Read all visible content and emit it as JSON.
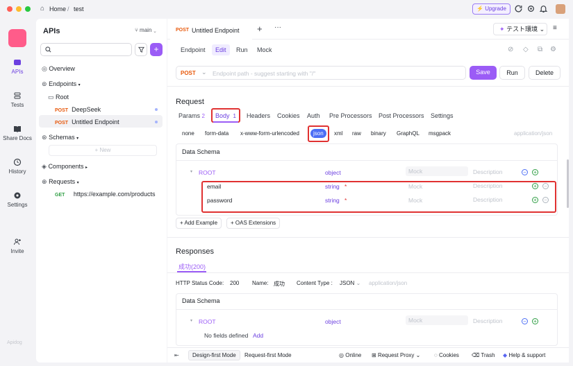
{
  "titlebar": {
    "home": "Home",
    "separator": "/",
    "project": "test",
    "upgrade": "Upgrade",
    "icons": [
      "refresh-icon",
      "gear-icon",
      "bell-icon"
    ]
  },
  "rail": {
    "items": [
      {
        "label": "APIs",
        "icon": "api-icon"
      },
      {
        "label": "Tests",
        "icon": "tests-icon"
      },
      {
        "label": "Share Docs",
        "icon": "book-icon"
      },
      {
        "label": "History",
        "icon": "history-icon"
      },
      {
        "label": "Settings",
        "icon": "settings-icon"
      },
      {
        "label": "Invite",
        "icon": "invite-icon"
      }
    ],
    "watermark": "Apidog"
  },
  "sidebar": {
    "title": "APIs",
    "branch": "main",
    "new_label": "+ New",
    "overview": "Overview",
    "endpoints": "Endpoints",
    "root": "Root",
    "ep1_method": "POST",
    "ep1_name": "DeepSeek",
    "ep2_method": "POST",
    "ep2_name": "Untitled Endpoint",
    "schemas": "Schemas",
    "components": "Components",
    "requests": "Requests",
    "req_method": "GET",
    "req_url": "https://example.com/products"
  },
  "tabs": {
    "method": "POST",
    "title": "Untitled Endpoint",
    "env": "テスト環境"
  },
  "subtabs": {
    "endpoint": "Endpoint",
    "edit": "Edit",
    "run": "Run",
    "mock": "Mock"
  },
  "urlbar": {
    "method": "POST",
    "placeholder": "Endpoint path - suggest starting with \"/\"",
    "save": "Save",
    "run": "Run",
    "delete": "Delete"
  },
  "request": {
    "title": "Request",
    "tabs": [
      {
        "label": "Params",
        "count": "2"
      },
      {
        "label": "Body",
        "count": "1"
      },
      {
        "label": "Headers"
      },
      {
        "label": "Cookies"
      },
      {
        "label": "Auth"
      },
      {
        "label": "Pre Processors"
      },
      {
        "label": "Post Processors"
      },
      {
        "label": "Settings"
      }
    ],
    "formats": [
      "none",
      "form-data",
      "x-www-form-urlencoded",
      "json",
      "xml",
      "raw",
      "binary",
      "GraphQL",
      "msgpack"
    ],
    "content_type": "application/json",
    "schema_title": "Data Schema",
    "root": "ROOT",
    "root_type": "object",
    "mock_ph": "Mock",
    "desc_ph": "Description",
    "fields": [
      {
        "name": "email",
        "type": "string",
        "required": "*"
      },
      {
        "name": "password",
        "type": "string",
        "required": "*"
      }
    ],
    "add_example": "+ Add Example",
    "oas": "+ OAS Extensions"
  },
  "responses": {
    "title": "Responses",
    "tab": "成功(200)",
    "status_label": "HTTP Status Code:",
    "status": "200",
    "name_label": "Name:",
    "name": "成功",
    "ctype_label": "Content Type :",
    "ctype": "JSON",
    "ctype_hint": "application/json",
    "schema_title": "Data Schema",
    "root": "ROOT",
    "root_type": "object",
    "no_fields": "No fields defined",
    "add": "Add"
  },
  "bottombar": {
    "design_mode": "Design-first Mode",
    "request_mode": "Request-first Mode",
    "online": "Online",
    "proxy": "Request Proxy",
    "cookies": "Cookies",
    "trash": "Trash",
    "help": "Help & support"
  },
  "colors": {
    "accent": "#9b5cf6",
    "post": "#e8590c",
    "get": "#2f9e44",
    "highlight": "#e03131"
  }
}
